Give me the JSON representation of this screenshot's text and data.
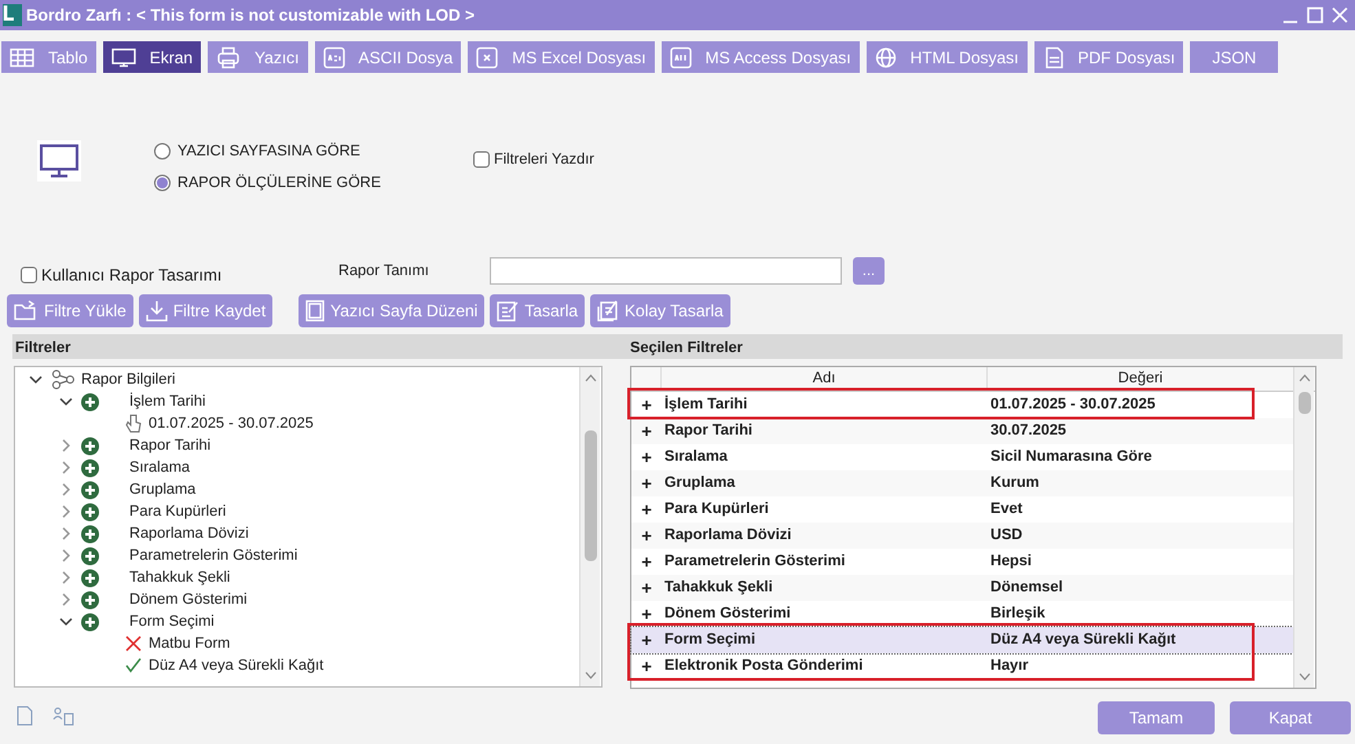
{
  "window": {
    "title": "Bordro Zarfı : < This form is not customizable with LOD >"
  },
  "tabs": [
    {
      "label": "Tablo",
      "selected": false
    },
    {
      "label": "Ekran",
      "selected": true
    },
    {
      "label": "Yazıcı",
      "selected": false
    },
    {
      "label": "ASCII Dosya",
      "selected": false
    },
    {
      "label": "MS Excel Dosyası",
      "selected": false
    },
    {
      "label": "MS Access Dosyası",
      "selected": false
    },
    {
      "label": "HTML Dosyası",
      "selected": false
    },
    {
      "label": "PDF Dosyası",
      "selected": false
    },
    {
      "label": "JSON",
      "selected": false
    }
  ],
  "output_options": [
    {
      "label": "YAZICI SAYFASINA GÖRE",
      "selected": false
    },
    {
      "label": "RAPOR ÖLÇÜLERİNE GÖRE",
      "selected": true
    }
  ],
  "print_filters": {
    "label": "Filtreleri Yazdır",
    "checked": false
  },
  "user_design": {
    "label": "Kullanıcı Rapor Tasarımı",
    "checked": false
  },
  "report_definition": {
    "label": "Rapor Tanımı",
    "browse": "..."
  },
  "actions": [
    "Filtre Yükle",
    "Filtre Kaydet",
    "Yazıcı Sayfa Düzeni",
    "Tasarla",
    "Kolay Tasarla"
  ],
  "filters_header": "Filtreler",
  "selected_header": "Seçilen Filtreler",
  "tree": [
    {
      "label": "Rapor Bilgileri",
      "kind": "root",
      "expanded": true,
      "children": [
        {
          "label": "İşlem Tarihi",
          "kind": "filter",
          "expanded": true,
          "children": [
            {
              "label": "01.07.2025 - 30.07.2025",
              "kind": "value"
            }
          ]
        },
        {
          "label": "Rapor Tarihi",
          "kind": "filter",
          "expanded": false
        },
        {
          "label": "Sıralama",
          "kind": "filter",
          "expanded": false
        },
        {
          "label": "Gruplama",
          "kind": "filter",
          "expanded": false
        },
        {
          "label": "Para Kupürleri",
          "kind": "filter",
          "expanded": false
        },
        {
          "label": "Raporlama Dövizi",
          "kind": "filter",
          "expanded": false
        },
        {
          "label": "Parametrelerin Gösterimi",
          "kind": "filter",
          "expanded": false
        },
        {
          "label": "Tahakkuk Şekli",
          "kind": "filter",
          "expanded": false
        },
        {
          "label": "Dönem Gösterimi",
          "kind": "filter",
          "expanded": false
        },
        {
          "label": "Form Seçimi",
          "kind": "filter",
          "expanded": true,
          "children": [
            {
              "label": "Matbu Form",
              "kind": "unchecked"
            },
            {
              "label": "Düz A4 veya Sürekli Kağıt",
              "kind": "checked"
            }
          ]
        }
      ]
    }
  ],
  "grid": {
    "columns": [
      "Adı",
      "Değeri"
    ],
    "rows": [
      {
        "expander": "+",
        "name": "İşlem Tarihi",
        "value": "01.07.2025 - 30.07.2025",
        "selected": false,
        "highlighted": true
      },
      {
        "expander": "+",
        "name": "Rapor Tarihi",
        "value": "30.07.2025",
        "selected": false,
        "highlighted": false
      },
      {
        "expander": "+",
        "name": "Sıralama",
        "value": "Sicil Numarasına Göre",
        "selected": false,
        "highlighted": false
      },
      {
        "expander": "+",
        "name": "Gruplama",
        "value": "Kurum",
        "selected": false,
        "highlighted": false
      },
      {
        "expander": "+",
        "name": "Para Kupürleri",
        "value": "Evet",
        "selected": false,
        "highlighted": false
      },
      {
        "expander": "+",
        "name": "Raporlama Dövizi",
        "value": "USD",
        "selected": false,
        "highlighted": false
      },
      {
        "expander": "+",
        "name": "Parametrelerin Gösterimi",
        "value": "Hepsi",
        "selected": false,
        "highlighted": false
      },
      {
        "expander": "+",
        "name": "Tahakkuk Şekli",
        "value": "Dönemsel",
        "selected": false,
        "highlighted": false
      },
      {
        "expander": "+",
        "name": "Dönem Gösterimi",
        "value": "Birleşik",
        "selected": false,
        "highlighted": false
      },
      {
        "expander": "+",
        "name": "Form Seçimi",
        "value": "Düz A4 veya Sürekli Kağıt",
        "selected": true,
        "highlighted": true
      },
      {
        "expander": "+",
        "name": "Elektronik Posta Gönderimi",
        "value": "Hayır",
        "selected": false,
        "highlighted": true
      }
    ]
  },
  "buttons": [
    "Tamam",
    "Kapat"
  ]
}
